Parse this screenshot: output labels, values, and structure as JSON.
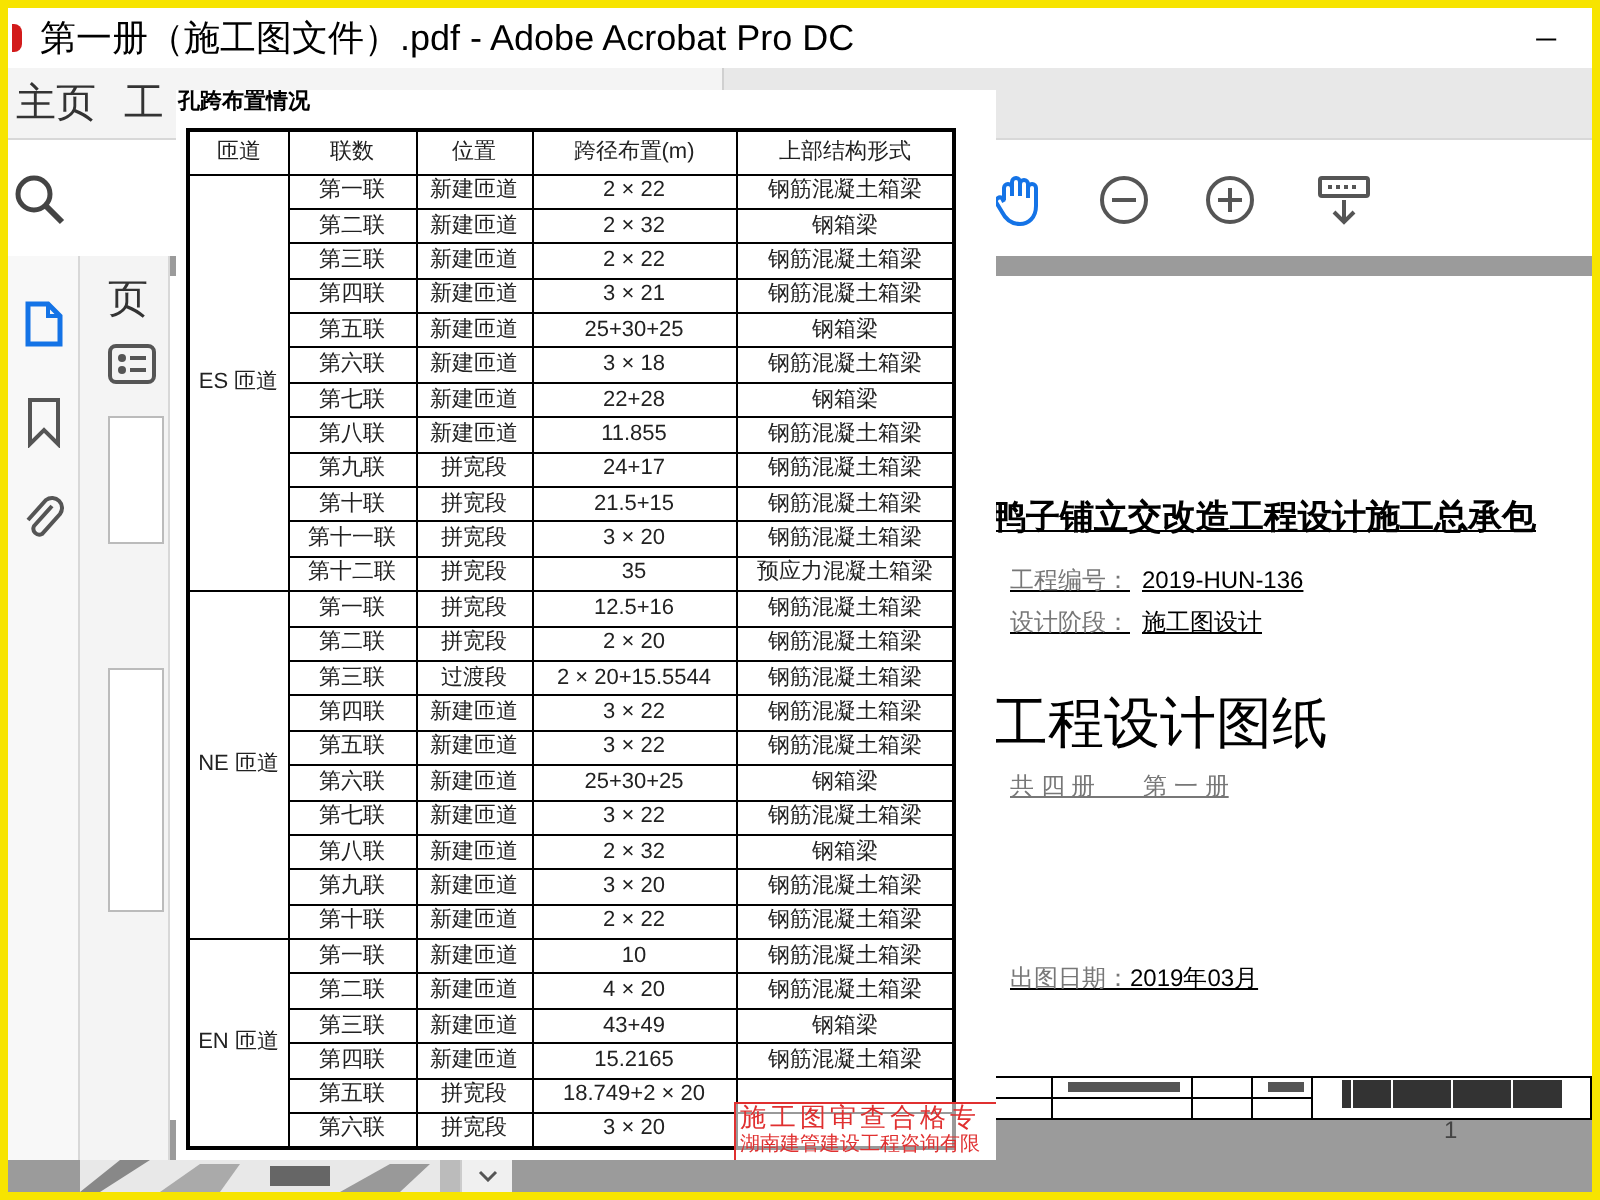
{
  "window": {
    "title": "第一册（施工图文件）.pdf - Adobe Acrobat Pro DC",
    "minimize": "─"
  },
  "tabs": [
    {
      "label": "主页",
      "selected": false
    },
    {
      "label": "工",
      "selected": false
    }
  ],
  "side_panel": {
    "label": "页"
  },
  "popup": {
    "caption": "孔跨布置情况",
    "columns": [
      "匝道",
      "联数",
      "位置",
      "跨径布置(m)",
      "上部结构形式"
    ],
    "groups": [
      {
        "ramp": "ES 匝道",
        "rows": [
          {
            "no": "第一联",
            "position": "新建匝道",
            "span": "2 × 22",
            "structure": "钢筋混凝土箱梁"
          },
          {
            "no": "第二联",
            "position": "新建匝道",
            "span": "2 × 32",
            "structure": "钢箱梁"
          },
          {
            "no": "第三联",
            "position": "新建匝道",
            "span": "2 × 22",
            "structure": "钢筋混凝土箱梁"
          },
          {
            "no": "第四联",
            "position": "新建匝道",
            "span": "3 × 21",
            "structure": "钢筋混凝土箱梁"
          },
          {
            "no": "第五联",
            "position": "新建匝道",
            "span": "25+30+25",
            "structure": "钢箱梁"
          },
          {
            "no": "第六联",
            "position": "新建匝道",
            "span": "3 × 18",
            "structure": "钢筋混凝土箱梁"
          },
          {
            "no": "第七联",
            "position": "新建匝道",
            "span": "22+28",
            "structure": "钢箱梁"
          },
          {
            "no": "第八联",
            "position": "新建匝道",
            "span": "11.855",
            "structure": "钢筋混凝土箱梁"
          },
          {
            "no": "第九联",
            "position": "拼宽段",
            "span": "24+17",
            "structure": "钢筋混凝土箱梁"
          },
          {
            "no": "第十联",
            "position": "拼宽段",
            "span": "21.5+15",
            "structure": "钢筋混凝土箱梁"
          },
          {
            "no": "第十一联",
            "position": "拼宽段",
            "span": "3 × 20",
            "structure": "钢筋混凝土箱梁"
          },
          {
            "no": "第十二联",
            "position": "拼宽段",
            "span": "35",
            "structure": "预应力混凝土箱梁"
          }
        ]
      },
      {
        "ramp": "NE 匝道",
        "rows": [
          {
            "no": "第一联",
            "position": "拼宽段",
            "span": "12.5+16",
            "structure": "钢筋混凝土箱梁"
          },
          {
            "no": "第二联",
            "position": "拼宽段",
            "span": "2 × 20",
            "structure": "钢筋混凝土箱梁"
          },
          {
            "no": "第三联",
            "position": "过渡段",
            "span": "2 × 20+15.5544",
            "structure": "钢筋混凝土箱梁"
          },
          {
            "no": "第四联",
            "position": "新建匝道",
            "span": "3 × 22",
            "structure": "钢筋混凝土箱梁"
          },
          {
            "no": "第五联",
            "position": "新建匝道",
            "span": "3 × 22",
            "structure": "钢筋混凝土箱梁"
          },
          {
            "no": "第六联",
            "position": "新建匝道",
            "span": "25+30+25",
            "structure": "钢箱梁"
          },
          {
            "no": "第七联",
            "position": "新建匝道",
            "span": "3 × 22",
            "structure": "钢筋混凝土箱梁"
          },
          {
            "no": "第八联",
            "position": "新建匝道",
            "span": "2 × 32",
            "structure": "钢箱梁"
          },
          {
            "no": "第九联",
            "position": "新建匝道",
            "span": "3 × 20",
            "structure": "钢筋混凝土箱梁"
          },
          {
            "no": "第十联",
            "position": "新建匝道",
            "span": "2 × 22",
            "structure": "钢筋混凝土箱梁"
          }
        ]
      },
      {
        "ramp": "EN 匝道",
        "rows": [
          {
            "no": "第一联",
            "position": "新建匝道",
            "span": "10",
            "structure": "钢筋混凝土箱梁"
          },
          {
            "no": "第二联",
            "position": "新建匝道",
            "span": "4 × 20",
            "structure": "钢筋混凝土箱梁"
          },
          {
            "no": "第三联",
            "position": "新建匝道",
            "span": "43+49",
            "structure": "钢箱梁"
          },
          {
            "no": "第四联",
            "position": "新建匝道",
            "span": "15.2165",
            "structure": "钢筋混凝土箱梁"
          },
          {
            "no": "第五联",
            "position": "拼宽段",
            "span": "18.749+2 × 20"
          },
          {
            "no": "第六联",
            "position": "拼宽段",
            "span": "3 × 20"
          }
        ]
      }
    ],
    "stamp": [
      "施工图审查合格专",
      "湖南建管建设工程咨询有限"
    ]
  },
  "document": {
    "project_title": "鸭子铺立交改造工程设计施工总承包",
    "fields": [
      {
        "label": "工程编号：",
        "value": "2019-HUN-136"
      },
      {
        "label": "设计阶段：",
        "value": "施工图设计"
      }
    ],
    "heading": "工程设计图纸",
    "volume": "共 四 册　　第 一 册",
    "date_label": "出图日期：",
    "date": "2019年03月",
    "page_number": "1"
  }
}
